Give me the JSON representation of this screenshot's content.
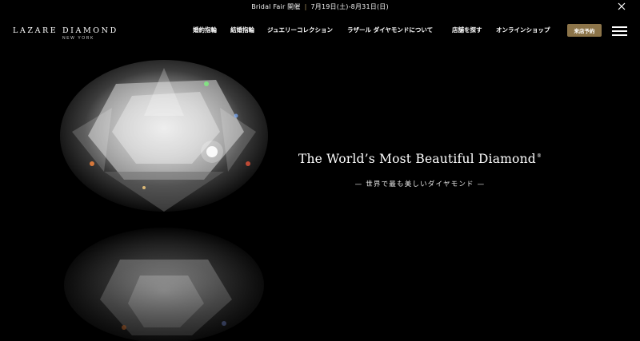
{
  "announcement": {
    "event": "Bridal Fair 開催",
    "separator": "|",
    "dates": "7月19日(土)-8月31日(日)",
    "close_icon": "close-icon"
  },
  "header": {
    "logo_main": "LAZARE DIAMOND",
    "logo_sub": "NEW YORK",
    "nav": [
      "婚約指輪",
      "結婚指輪",
      "ジュエリーコレクション",
      "ラザール ダイヤモンドについて",
      "店舗を探す",
      "オンラインショップ"
    ],
    "reserve_label": "来店予約",
    "menu_icon": "hamburger-menu-icon"
  },
  "hero": {
    "title": "The World’s Most Beautiful Diamond",
    "title_mark": "®",
    "subtitle": "— 世界で最も美しいダイヤモンド —",
    "image_subject": "brilliant-cut diamond with reflection"
  },
  "colors": {
    "background": "#000000",
    "accent_gold": "#8c7449",
    "separator_gold": "#b39a63",
    "text": "#ffffff"
  }
}
